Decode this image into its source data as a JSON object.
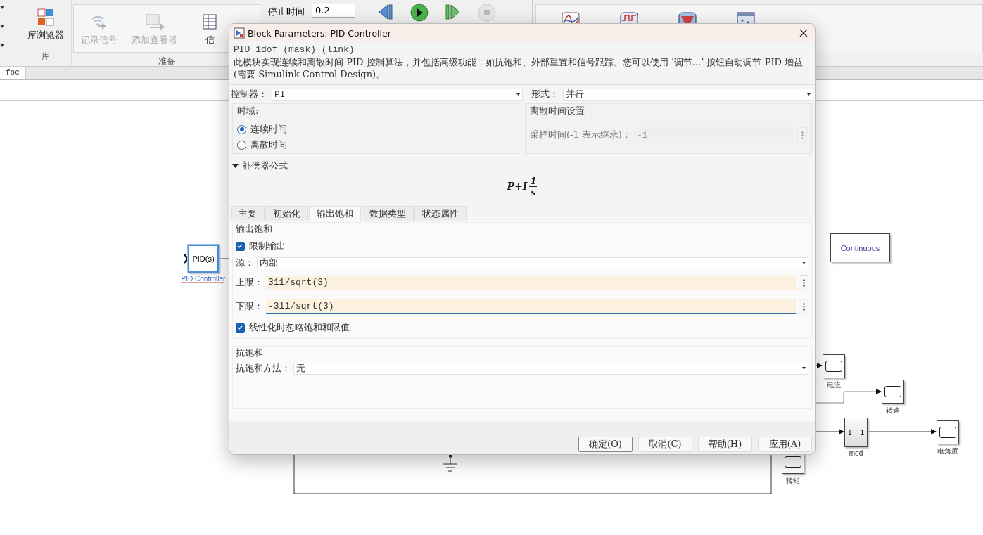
{
  "toolstrip": {
    "sections": [
      {
        "label": "库",
        "buttons": [
          {
            "label": "库浏览器",
            "kind": "library",
            "disabled": false
          }
        ]
      },
      {
        "label": "准备",
        "buttons": [
          {
            "label": "记录信号",
            "kind": "signal",
            "disabled": true
          },
          {
            "label": "添加查看器",
            "kind": "viewer",
            "disabled": true
          },
          {
            "label": "信",
            "kind": "table",
            "disabled": false
          }
        ]
      }
    ],
    "stop_time": {
      "label": "停止时间",
      "value": "0.2"
    },
    "sim_controls": [
      {
        "kind": "step_back",
        "disabled": false
      },
      {
        "kind": "run",
        "disabled": false
      },
      {
        "kind": "step_forward",
        "disabled": false
      },
      {
        "kind": "stop",
        "disabled": true
      }
    ],
    "apps": [
      {
        "kind": "sine"
      },
      {
        "kind": "pulse"
      },
      {
        "kind": "cone"
      },
      {
        "kind": "grid"
      }
    ]
  },
  "model_tabs": [
    {
      "label": "foc",
      "selected": true
    }
  ],
  "canvas": {
    "blocks": [
      {
        "kind": "pid",
        "text": "PID(s)",
        "caption": "PID Controller",
        "selected": true
      },
      {
        "kind": "label",
        "text": "Continuous"
      },
      {
        "kind": "scope",
        "caption": "电流"
      },
      {
        "kind": "scope",
        "caption": "转速"
      },
      {
        "kind": "mod",
        "inputs": "1",
        "outputs": "1",
        "caption": "mod"
      },
      {
        "kind": "scope",
        "caption": "电角度"
      },
      {
        "kind": "scope",
        "caption": "转矩"
      }
    ]
  },
  "dialog": {
    "title": "Block Parameters: PID Controller",
    "subtitle": "PID 1dof (mask) (link)",
    "description": "此模块实现连续和离散时间 PID 控制算法，并包括高级功能，如抗饱和、外部重置和信号跟踪。您可以使用 ’调节...’ 按钮自动调节 PID 增益(需要 Simulink Control Design)。",
    "controller": {
      "label": "控制器：",
      "value": "PI"
    },
    "form": {
      "label": "形式：",
      "value": "并行"
    },
    "time_domain": {
      "title": "时域:",
      "options": [
        {
          "label": "连续时间",
          "selected": true
        },
        {
          "label": "离散时间",
          "selected": false
        }
      ]
    },
    "discrete": {
      "title": "离散时间设置",
      "sample_time": {
        "label": "采样时间(-1 表示继承)：",
        "value": "-1",
        "disabled": true
      }
    },
    "compensator": {
      "label": "补偿器公式",
      "expanded": true,
      "formula": {
        "lhs": "P+I",
        "numerator": "1",
        "denominator": "s"
      }
    },
    "tabs": [
      {
        "label": "主要",
        "selected": false
      },
      {
        "label": "初始化",
        "selected": false
      },
      {
        "label": "输出饱和",
        "selected": true
      },
      {
        "label": "数据类型",
        "selected": false
      },
      {
        "label": "状态属性",
        "selected": false
      }
    ],
    "saturation": {
      "title": "输出饱和",
      "limit_output": {
        "label": "限制输出",
        "checked": true
      },
      "source": {
        "label": "源：",
        "value": "内部"
      },
      "upper": {
        "label": "上限：",
        "value": "311/sqrt(3)",
        "focused": false
      },
      "lower": {
        "label": "下限：",
        "value": "-311/sqrt(3)",
        "focused": true
      },
      "ignore": {
        "label": "线性化时忽略饱和和限值",
        "checked": true
      }
    },
    "anti_windup": {
      "title": "抗饱和",
      "method": {
        "label": "抗饱和方法：",
        "value": "无"
      }
    },
    "buttons": [
      {
        "label": "确定(O)",
        "default": true
      },
      {
        "label": "取消(C)",
        "default": false
      },
      {
        "label": "帮助(H)",
        "default": false
      },
      {
        "label": "应用(A)",
        "default": false
      }
    ]
  }
}
